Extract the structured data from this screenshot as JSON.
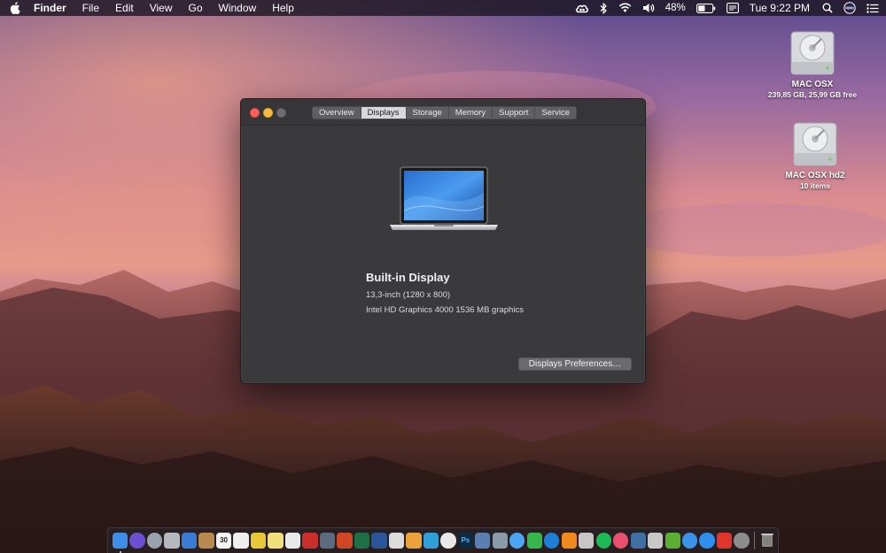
{
  "menubar": {
    "app_name": "Finder",
    "menus": [
      "File",
      "Edit",
      "View",
      "Go",
      "Window",
      "Help"
    ],
    "battery_percent": "48%",
    "clock": "Tue 9:22 PM",
    "status_icons": [
      "creative-cloud-icon",
      "bluetooth-icon",
      "wifi-icon",
      "volume-icon",
      "battery-icon",
      "input-menu-icon",
      "spotlight-search-icon",
      "siri-icon",
      "notification-center-icon"
    ]
  },
  "desktop": {
    "drives": [
      {
        "name": "MAC OSX",
        "info": "239,85 GB, 25,99 GB free"
      },
      {
        "name": "MAC OSX hd2",
        "info": "10 items"
      }
    ]
  },
  "about_window": {
    "tabs": [
      "Overview",
      "Displays",
      "Storage",
      "Memory",
      "Support",
      "Service"
    ],
    "active_tab": "Displays",
    "display_title": "Built-in Display",
    "display_size": "13,3-inch (1280 x 800)",
    "display_graphics": "Intel HD Graphics 4000 1536 MB graphics",
    "prefs_button": "Displays Preferences…"
  },
  "dock": {
    "apps": [
      {
        "name": "finder",
        "color": "#3d8ee8",
        "running": true
      },
      {
        "name": "siri",
        "color": "#6a4fd0"
      },
      {
        "name": "launchpad",
        "color": "#9aa3ad"
      },
      {
        "name": "mission-control",
        "color": "#b5b8bd"
      },
      {
        "name": "preview",
        "color": "#3a7bd5"
      },
      {
        "name": "notebook",
        "color": "#b8894f"
      },
      {
        "name": "calendar",
        "color": "#f4f4f4",
        "text": "30"
      },
      {
        "name": "textedit",
        "color": "#eeeeee"
      },
      {
        "name": "stickies",
        "color": "#e8c838"
      },
      {
        "name": "notes",
        "color": "#f2e07a"
      },
      {
        "name": "list",
        "color": "#e9e9e9"
      },
      {
        "name": "acrobat",
        "color": "#c9302c"
      },
      {
        "name": "keynote-app",
        "color": "#5b6c80"
      },
      {
        "name": "powerpoint",
        "color": "#d04726"
      },
      {
        "name": "excel",
        "color": "#1e7145"
      },
      {
        "name": "word",
        "color": "#2b579a"
      },
      {
        "name": "doc-viewer",
        "color": "#dcdcdc"
      },
      {
        "name": "pages",
        "color": "#e9a33a"
      },
      {
        "name": "os-x-app",
        "color": "#2f9fd8"
      },
      {
        "name": "chrome",
        "color": "#e8e8e8"
      },
      {
        "name": "photoshop",
        "color": "#0d2a3e",
        "text": "Ps"
      },
      {
        "name": "xcode-tools",
        "color": "#5a7fb0"
      },
      {
        "name": "migration",
        "color": "#8a9aa8"
      },
      {
        "name": "messages",
        "color": "#4aa6f2"
      },
      {
        "name": "facetime",
        "color": "#35b54a"
      },
      {
        "name": "edge",
        "color": "#1f7fd6"
      },
      {
        "name": "vlc",
        "color": "#f08a1c"
      },
      {
        "name": "disk-utility",
        "color": "#c7c7c7"
      },
      {
        "name": "spotify",
        "color": "#1db954"
      },
      {
        "name": "itunes",
        "color": "#e8506e"
      },
      {
        "name": "network-utility",
        "color": "#3f6fa3"
      },
      {
        "name": "system-info",
        "color": "#c8c8c8"
      },
      {
        "name": "evernote",
        "color": "#5bb033"
      },
      {
        "name": "safari",
        "color": "#3a93e6"
      },
      {
        "name": "app-store",
        "color": "#2e8ff0"
      },
      {
        "name": "anydesk",
        "color": "#e0352b"
      },
      {
        "name": "system-preferences",
        "color": "#8d8d8d"
      }
    ],
    "trash": {
      "name": "trash",
      "color": "#9b9b9b"
    }
  }
}
